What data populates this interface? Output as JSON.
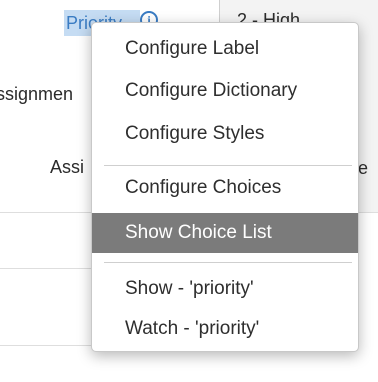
{
  "form": {
    "priority_label": "Priority",
    "assignment_label": "ssignmen",
    "assigned_label": "Assi",
    "priority_value": "2 - High",
    "right_fragment": "e"
  },
  "menu": {
    "items": [
      {
        "label": "Configure Label"
      },
      {
        "label": "Configure Dictionary"
      },
      {
        "label": "Configure Styles"
      },
      {
        "label": "Configure Choices"
      },
      {
        "label": "Show Choice List",
        "highlighted": true
      },
      {
        "label": "Show - 'priority'"
      },
      {
        "label": "Watch - 'priority'"
      }
    ]
  },
  "colors": {
    "highlight_bg": "#7b7b7b",
    "link_blue": "#3a7cc3",
    "selection_bg": "#c5dcf3"
  },
  "icons": {
    "info": "info-icon"
  }
}
